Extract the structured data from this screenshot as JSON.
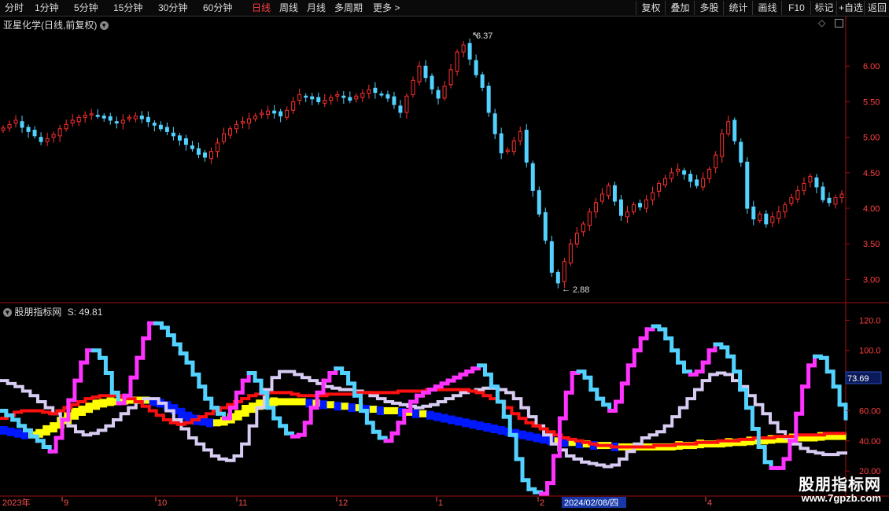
{
  "toolbar": {
    "periods": [
      "分时",
      "1分钟",
      "5分钟",
      "15分钟",
      "30分钟",
      "60分钟",
      "日线",
      "周线",
      "月线",
      "多周期",
      "更多"
    ],
    "active_period": "日线",
    "right_buttons": [
      "复权",
      "叠加",
      "多股",
      "统计",
      "画线",
      "F10",
      "标记",
      "+自选",
      "返回"
    ]
  },
  "main_panel": {
    "title": "亚星化学(日线,前复权)",
    "high_label": "6.37",
    "low_label": "2.88",
    "y_ticks": [
      "6.00",
      "5.50",
      "5.00",
      "4.50",
      "4.00",
      "3.50",
      "3.00"
    ]
  },
  "indicator_panel": {
    "title": "股朋指标网",
    "value_label": "S: 49.81",
    "y_ticks": [
      "120.0",
      "100.0",
      "80.00",
      "60.00",
      "40.00",
      "20.00"
    ],
    "current_value": "73.69"
  },
  "time_axis": {
    "labels": [
      "2023年",
      "9",
      "10",
      "11",
      "12",
      "1",
      "2",
      "2024/02/08/四",
      "4"
    ]
  },
  "watermark": {
    "text": "股朋指标网",
    "url": "www.7gpzb.com"
  },
  "colors": {
    "up": "#ff3030",
    "down": "#54d2ff",
    "magenta": "#ff33ff",
    "yellow": "#ffff00",
    "blue": "#0018ff",
    "lavender": "#d8ccf2",
    "red": "#ff1010"
  },
  "chart_data": [
    {
      "type": "candlestick",
      "title": "亚星化学(日线,前复权)",
      "ylim": [
        2.75,
        6.6
      ],
      "y_ticks": [
        3.0,
        3.5,
        4.0,
        4.5,
        5.0,
        5.5,
        6.0
      ],
      "max": 6.37,
      "min": 2.88,
      "closes": [
        5.13,
        5.18,
        5.24,
        5.14,
        5.08,
        5.02,
        4.94,
        4.98,
        5.04,
        5.12,
        5.18,
        5.24,
        5.28,
        5.31,
        5.33,
        5.3,
        5.27,
        5.24,
        5.2,
        5.24,
        5.28,
        5.3,
        5.26,
        5.22,
        5.17,
        5.12,
        5.08,
        5.02,
        4.96,
        4.9,
        4.84,
        4.76,
        4.72,
        4.8,
        4.92,
        5.05,
        5.12,
        5.18,
        5.22,
        5.26,
        5.3,
        5.34,
        5.37,
        5.34,
        5.3,
        5.38,
        5.5,
        5.6,
        5.57,
        5.54,
        5.5,
        5.52,
        5.56,
        5.6,
        5.56,
        5.52,
        5.58,
        5.62,
        5.67,
        5.63,
        5.6,
        5.55,
        5.46,
        5.35,
        5.58,
        5.8,
        6.0,
        5.84,
        5.68,
        5.55,
        5.72,
        5.95,
        6.2,
        6.3,
        6.1,
        5.88,
        5.7,
        5.35,
        5.05,
        4.78,
        4.82,
        4.95,
        5.08,
        4.65,
        4.25,
        3.92,
        3.55,
        3.1,
        2.95,
        3.25,
        3.5,
        3.65,
        3.78,
        3.95,
        4.08,
        4.2,
        4.32,
        4.1,
        3.9,
        3.95,
        4.05,
        4.02,
        4.12,
        4.22,
        4.35,
        4.42,
        4.5,
        4.55,
        4.48,
        4.38,
        4.32,
        4.42,
        4.55,
        4.75,
        5.05,
        5.22,
        4.95,
        4.65,
        4.0,
        3.85,
        3.92,
        3.78,
        3.88,
        3.95,
        4.05,
        4.15,
        4.25,
        4.35,
        4.45,
        4.3,
        4.12,
        4.08,
        4.15,
        4.2
      ]
    },
    {
      "type": "line",
      "title": "股朋指标网",
      "ylim": [
        5,
        128
      ],
      "y_ticks": [
        20,
        40,
        60,
        80,
        100,
        120
      ],
      "series_value_label": "S: 49.81",
      "current_value": 73.69,
      "series": [
        {
          "values": [
            60,
            57,
            54,
            50,
            47,
            43,
            40,
            36,
            33,
            42,
            54,
            67,
            80,
            92,
            100,
            100,
            95,
            85,
            72,
            65,
            70,
            82,
            95,
            108,
            118,
            118,
            115,
            110,
            104,
            98,
            92,
            84,
            76,
            68,
            62,
            58,
            55,
            62,
            72,
            80,
            85,
            80,
            72,
            62,
            55,
            50,
            45,
            43,
            44,
            52,
            62,
            72,
            80,
            85,
            88,
            85,
            78,
            70,
            60,
            52,
            46,
            42,
            40,
            45,
            52,
            60,
            66,
            70,
            72,
            74,
            76,
            78,
            80,
            82,
            84,
            86,
            88,
            90,
            84,
            76,
            66,
            56,
            44,
            28,
            14,
            8,
            6,
            5,
            12,
            30,
            55,
            72,
            85,
            86,
            82,
            74,
            68,
            64,
            60,
            66,
            78,
            90,
            100,
            108,
            114,
            116,
            114,
            108,
            100,
            92,
            86,
            84,
            86,
            92,
            100,
            104,
            102,
            96,
            86,
            74,
            62,
            48,
            36,
            26,
            22,
            22,
            28,
            40,
            58,
            76,
            90,
            96,
            95,
            86,
            76,
            64,
            55
          ]
        },
        {
          "values": [
            80,
            78,
            76,
            73,
            70,
            66,
            62,
            58,
            54,
            50,
            46,
            44,
            45,
            47,
            50,
            54,
            58,
            62,
            66,
            68,
            68,
            65,
            60,
            54,
            48,
            42,
            38,
            34,
            30,
            28,
            27,
            30,
            38,
            50,
            62,
            74,
            82,
            86,
            86,
            84,
            82,
            80,
            78,
            76,
            75,
            74,
            74,
            73,
            72,
            70,
            68,
            66,
            65,
            64,
            63,
            62,
            63,
            64,
            66,
            68,
            70,
            72,
            73,
            74,
            75,
            75,
            74,
            72,
            68,
            62,
            56,
            50,
            44,
            38,
            34,
            30,
            28,
            26,
            25,
            24,
            23,
            24,
            28,
            33,
            38,
            42,
            44,
            46,
            50,
            56,
            62,
            68,
            74,
            80,
            84,
            85,
            84,
            80,
            76,
            70,
            64,
            58,
            52,
            46,
            42,
            38,
            35,
            33,
            32,
            31,
            31,
            32,
            33
          ]
        },
        {
          "values": [
            48,
            47,
            46,
            45,
            44,
            44,
            45,
            47,
            49,
            52,
            55,
            58,
            60,
            62,
            64,
            65,
            66,
            66,
            67,
            67,
            67,
            67,
            66,
            65,
            63,
            61,
            58,
            56,
            54,
            53,
            52,
            52,
            53,
            55,
            57,
            60,
            62,
            64,
            65,
            66,
            66,
            66,
            66,
            66,
            65,
            65,
            64,
            64,
            63,
            63,
            62,
            62,
            61,
            61,
            60,
            60,
            60,
            59,
            59,
            58,
            58,
            57,
            56,
            55,
            54,
            53,
            52,
            51,
            50,
            49,
            48,
            47,
            46,
            45,
            44,
            43,
            42,
            41,
            40,
            40,
            39,
            39,
            38,
            38,
            37,
            37,
            37,
            36,
            36,
            36,
            36,
            36,
            36,
            36,
            36,
            36,
            37,
            37,
            37,
            38,
            38,
            38,
            38,
            39,
            39,
            39,
            40,
            40,
            40,
            41,
            41,
            41,
            42,
            42,
            42,
            42,
            43,
            43,
            43,
            43
          ]
        },
        {
          "values": [
            55,
            57,
            59,
            60,
            60,
            60,
            59,
            58,
            60,
            62,
            64,
            66,
            68,
            69,
            70,
            70,
            70,
            69,
            68,
            66,
            63,
            60,
            57,
            54,
            52,
            51,
            52,
            54,
            56,
            58,
            60,
            62,
            64,
            66,
            68,
            70,
            71,
            72,
            72,
            72,
            72,
            71,
            70,
            70,
            70,
            70,
            71,
            71,
            71,
            71,
            72,
            72,
            72,
            72,
            72,
            72,
            73,
            73,
            73,
            73,
            74,
            74,
            74,
            74,
            74,
            74,
            73,
            72,
            70,
            68,
            66,
            62,
            58,
            55,
            52,
            50,
            48,
            46,
            44,
            42,
            41,
            40,
            39,
            38,
            37,
            37,
            36,
            36,
            36,
            36,
            36,
            36,
            37,
            37,
            37,
            38,
            38,
            38,
            39,
            39,
            39,
            40,
            40,
            40,
            41,
            41,
            42,
            42,
            42,
            43,
            43,
            43,
            44,
            44,
            44,
            44,
            45,
            45,
            45,
            45
          ]
        }
      ]
    }
  ]
}
